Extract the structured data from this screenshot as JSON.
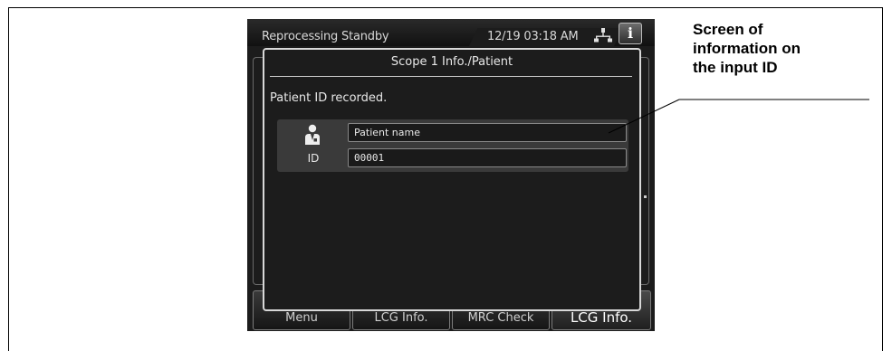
{
  "device": {
    "status_text": "Reprocessing Standby",
    "clock": "12/19 03:18 AM",
    "info_icon": "info-icon",
    "network_icon": "network-icon",
    "bottom_tabs": [
      {
        "label": "Menu"
      },
      {
        "label": "LCG Info."
      },
      {
        "label": "MRC Check"
      },
      {
        "label": "LCG Info."
      }
    ]
  },
  "dialog": {
    "title": "Scope 1 Info./Patient",
    "message": "Patient ID recorded.",
    "patient_icon": "patient-icon",
    "id_label": "ID",
    "name_field": "Patient name",
    "id_field": "00001"
  },
  "callout": {
    "lines": [
      "Screen of",
      "information on",
      "the input ID"
    ]
  },
  "colors": {
    "screen_bg": "#1c1c1c",
    "dialog_border": "#d8d8d8",
    "callout_text": "#000000"
  }
}
